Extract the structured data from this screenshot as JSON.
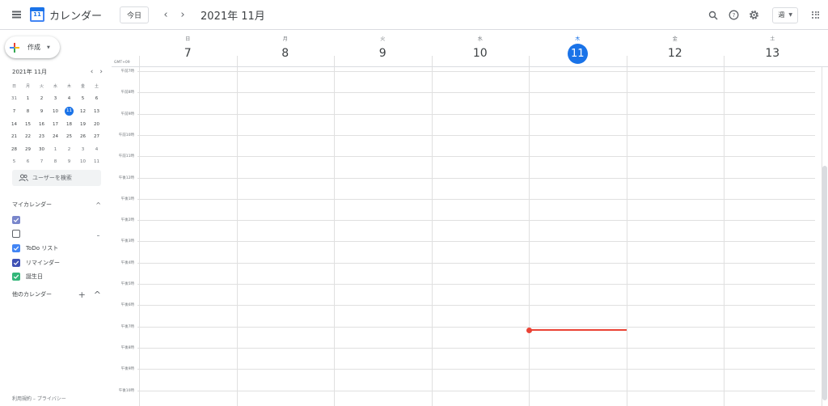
{
  "header": {
    "app_title": "カレンダー",
    "logo_day": "11",
    "today_label": "今日",
    "prev_symbol": "‹",
    "next_symbol": "›",
    "month_title": "2021年 11月",
    "view_label": "週",
    "view_caret": "▼"
  },
  "sidebar": {
    "create_label": "作成",
    "create_caret": "▼",
    "mini_calendar": {
      "title": "2021年 11月",
      "prev_symbol": "‹",
      "next_symbol": "›",
      "weekdays": [
        "日",
        "月",
        "火",
        "水",
        "木",
        "金",
        "土"
      ],
      "weeks": [
        [
          "31",
          "1",
          "2",
          "3",
          "4",
          "5",
          "6"
        ],
        [
          "7",
          "8",
          "9",
          "10",
          "11",
          "12",
          "13"
        ],
        [
          "14",
          "15",
          "16",
          "17",
          "18",
          "19",
          "20"
        ],
        [
          "21",
          "22",
          "23",
          "24",
          "25",
          "26",
          "27"
        ],
        [
          "28",
          "29",
          "30",
          "1",
          "2",
          "3",
          "4"
        ],
        [
          "5",
          "6",
          "7",
          "8",
          "9",
          "10",
          "11"
        ]
      ],
      "today": "11"
    },
    "people_search_label": "ユーザーを検索",
    "my_calendars_title": "マイカレンダー",
    "my_calendars_caret": "^",
    "calendars": [
      {
        "label": "",
        "checked": true,
        "color": "#7986cb"
      },
      {
        "label": "",
        "checked": false,
        "color": "#5f6368"
      },
      {
        "label": "ToDo リスト",
        "checked": true,
        "color": "#4285f4"
      },
      {
        "label": "リマインダー",
        "checked": true,
        "color": "#3f51b5"
      },
      {
        "label": "誕生日",
        "checked": true,
        "color": "#33b679"
      }
    ],
    "other_calendars_title": "他のカレンダー",
    "other_add_symbol": "+",
    "other_caret": "^",
    "footer_terms": "利用規約",
    "footer_sep": " – ",
    "footer_privacy": "プライバシー"
  },
  "week": {
    "timezone": "GMT+09",
    "days": [
      {
        "weekday": "日",
        "date": "7",
        "today": false
      },
      {
        "weekday": "月",
        "date": "8",
        "today": false
      },
      {
        "weekday": "火",
        "date": "9",
        "today": false
      },
      {
        "weekday": "水",
        "date": "10",
        "today": false
      },
      {
        "weekday": "木",
        "date": "11",
        "today": true
      },
      {
        "weekday": "金",
        "date": "12",
        "today": false
      },
      {
        "weekday": "土",
        "date": "13",
        "today": false
      }
    ],
    "hours": [
      "午前7時",
      "午前8時",
      "午前9時",
      "午前10時",
      "午前11時",
      "午後12時",
      "午後1時",
      "午後2時",
      "午後3時",
      "午後4時",
      "午後5時",
      "午後6時",
      "午後7時",
      "午後8時",
      "午後9時",
      "午後10時"
    ],
    "now_time": "午後7時"
  },
  "colors": {
    "accent": "#1a73e8",
    "now_indicator": "#ea4335"
  }
}
